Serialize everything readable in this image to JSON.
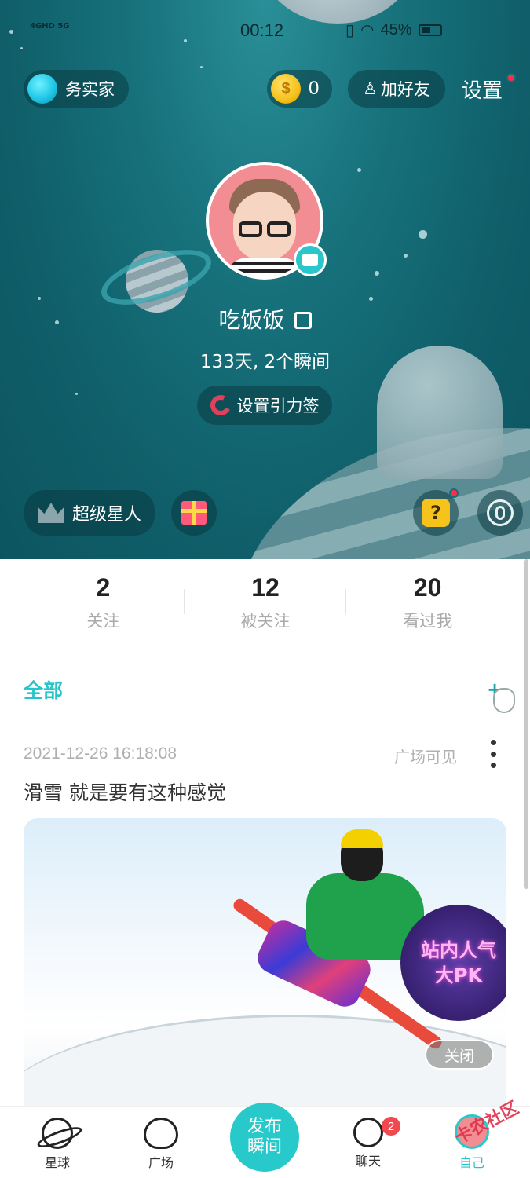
{
  "status_bar": {
    "network": "4GHD 5G",
    "time": "00:12",
    "battery": "45%"
  },
  "header": {
    "user_tag": "务实家",
    "coins": "0",
    "coin_symbol": "$",
    "add_friend": "加好友",
    "settings": "设置"
  },
  "profile": {
    "nickname": "吃饭饭",
    "stats": "133天, 2个瞬间",
    "gravity_tag": "设置引力签",
    "vip": "超级星人",
    "question_mark": "?"
  },
  "counters": [
    {
      "value": "2",
      "label": "关注"
    },
    {
      "value": "12",
      "label": "被关注"
    },
    {
      "value": "20",
      "label": "看过我"
    }
  ],
  "feed": {
    "tab_all": "全部",
    "plus": "+",
    "post": {
      "date": "2021-12-26 16:18:08",
      "visibility": "广场可见",
      "text": "滑雪 就是要有这种感觉",
      "promo_line1": "站内人气",
      "promo_line2": "大PK",
      "close": "关闭"
    }
  },
  "bottom_nav": {
    "planet": "星球",
    "square": "广场",
    "publish_line1": "发布",
    "publish_line2": "瞬间",
    "chat": "聊天",
    "chat_badge": "2",
    "me": "自己"
  },
  "watermark": "卡农社区",
  "colors": {
    "accent": "#26c5c9",
    "hero_bg": "#13707a",
    "badge_red": "#f2484f"
  }
}
